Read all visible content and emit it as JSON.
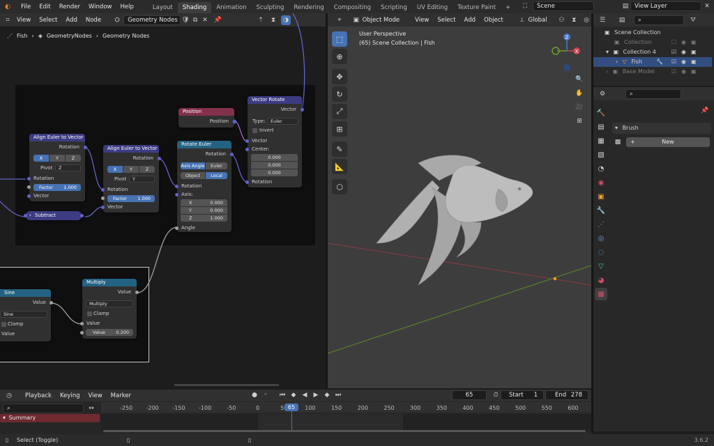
{
  "menu": [
    "File",
    "Edit",
    "Render",
    "Window",
    "Help"
  ],
  "workspaces": [
    "Layout",
    "Shading",
    "Animation",
    "Sculpting",
    "Rendering",
    "Compositing",
    "Scripting",
    "UV Editing",
    "Texture Paint"
  ],
  "active_workspace": "Shading",
  "add_workspace": "+",
  "scene_field": "Scene",
  "view_layer_field": "View Layer",
  "node_editor": {
    "header": [
      "View",
      "Select",
      "Add",
      "Node"
    ],
    "node_tree_name": "Geometry Nodes",
    "breadcrumb": [
      "Fish",
      "GeometryNodes",
      "Geometry Nodes"
    ],
    "nodes": {
      "align1": {
        "title": "Align Euler to Vector",
        "rotation": "Rotation",
        "x": "X",
        "y": "Y",
        "z": "Z",
        "pivot_label": "Pivot",
        "pivot": "Z",
        "in_rotation": "Rotation",
        "factor_label": "Factor",
        "factor": "1.000",
        "vector": "Vector"
      },
      "align2": {
        "title": "Align Euler to Vector",
        "rotation": "Rotation",
        "x": "X",
        "y": "Y",
        "z": "Z",
        "pivot_label": "Pivot",
        "pivot": "Y",
        "in_rotation": "Rotation",
        "factor_label": "Factor",
        "factor": "1.000",
        "vector": "Vector"
      },
      "position": {
        "title": "Position",
        "out": "Position"
      },
      "rotate_euler": {
        "title": "Rotate Euler",
        "rotation": "Rotation",
        "axis_angle": "Axis Angle",
        "euler": "Euler",
        "object": "Object",
        "local": "Local",
        "in_rotation": "Rotation",
        "axis": "Axis:",
        "x_label": "X",
        "x": "0.000",
        "y_label": "Y",
        "y": "0.000",
        "z_label": "Z",
        "z": "1.000",
        "angle": "Angle"
      },
      "vector_rotate": {
        "title": "Vector Rotate",
        "vector_out": "Vector",
        "type_label": "Type:",
        "type": "Euler",
        "invert": "Invert",
        "vector": "Vector",
        "center": "Center:",
        "c1": "0.000",
        "c2": "0.000",
        "c3": "0.000",
        "rotation": "Rotation"
      },
      "subtract": {
        "title": "Subtract"
      },
      "sine": {
        "title": "Sine",
        "value_out": "Value",
        "op": "Sine",
        "clamp": "Clamp",
        "value_in": "Value"
      },
      "multiply": {
        "title": "Multiply",
        "value_out": "Value",
        "op": "Multiply",
        "clamp": "Clamp",
        "value_in": "Value",
        "value2_label": "Value",
        "value2": "0.200"
      }
    }
  },
  "viewport": {
    "mode": "Object Mode",
    "header": [
      "View",
      "Select",
      "Add",
      "Object"
    ],
    "transform": "Global",
    "perspective": "User Perspective",
    "collection_info": "(65) Scene Collection | Fish",
    "gizmo": {
      "z": "Z",
      "y": "Y",
      "x": "X"
    }
  },
  "outliner": {
    "search_placeholder": "",
    "rows": [
      {
        "label": "Scene Collection"
      },
      {
        "label": "Collection"
      },
      {
        "label": "Collection 4"
      },
      {
        "label": "Fish"
      },
      {
        "label": "Base Model"
      }
    ]
  },
  "properties": {
    "brush_label": "Brush",
    "new_button": "New",
    "new_plus": "+"
  },
  "timeline": {
    "header": [
      "Playback",
      "Keying",
      "View",
      "Marker"
    ],
    "current_frame": "65",
    "start_label": "Start",
    "start": "1",
    "end_label": "End",
    "end": "278",
    "ticks": [
      "-250",
      "-200",
      "-150",
      "-100",
      "-50",
      "0",
      "50",
      "100",
      "150",
      "200",
      "250",
      "300",
      "350",
      "400",
      "450",
      "500",
      "550",
      "600"
    ],
    "playhead": "65",
    "summary": "Summary"
  },
  "status": {
    "left": "Select (Toggle)",
    "version": "3.6.2"
  },
  "colors": {
    "accent": "#4772b3",
    "vector_header": "#3c3c83",
    "rotate_header": "#246283",
    "position_header": "#83314a",
    "math_header": "#246283",
    "summary": "#6e2a2f"
  }
}
